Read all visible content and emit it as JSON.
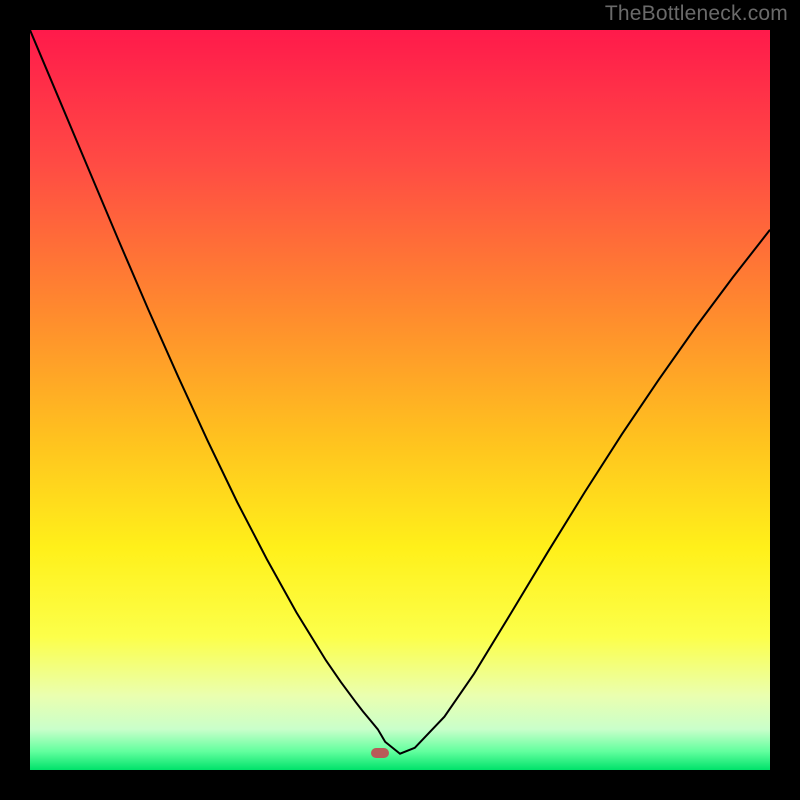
{
  "watermark": "TheBottleneck.com",
  "chart_data": {
    "type": "line",
    "title": "",
    "xlabel": "",
    "ylabel": "",
    "xlim": [
      0,
      100
    ],
    "ylim": [
      0,
      100
    ],
    "background_gradient": {
      "direction": "vertical",
      "stops": [
        {
          "pos": 0.0,
          "color": "#ff1a4b"
        },
        {
          "pos": 0.18,
          "color": "#ff4b44"
        },
        {
          "pos": 0.38,
          "color": "#ff8a2e"
        },
        {
          "pos": 0.55,
          "color": "#ffc11f"
        },
        {
          "pos": 0.7,
          "color": "#fff01a"
        },
        {
          "pos": 0.82,
          "color": "#fcff4a"
        },
        {
          "pos": 0.9,
          "color": "#eaffb0"
        },
        {
          "pos": 0.945,
          "color": "#c9ffca"
        },
        {
          "pos": 0.975,
          "color": "#62ff9e"
        },
        {
          "pos": 1.0,
          "color": "#00e26a"
        }
      ]
    },
    "series": [
      {
        "name": "bottleneck-curve",
        "color": "#000000",
        "x": [
          0,
          4,
          8,
          12,
          16,
          20,
          24,
          28,
          32,
          36,
          40,
          42,
          44,
          45,
          46,
          47,
          48,
          50,
          52,
          56,
          60,
          65,
          70,
          75,
          80,
          85,
          90,
          95,
          100
        ],
        "y": [
          100,
          90.5,
          81,
          71.5,
          62.2,
          53.2,
          44.5,
          36.2,
          28.5,
          21.3,
          14.8,
          11.9,
          9.2,
          7.9,
          6.7,
          5.5,
          3.8,
          2.2,
          3.0,
          7.2,
          13.0,
          21.2,
          29.5,
          37.6,
          45.4,
          52.8,
          59.9,
          66.6,
          73.0
        ]
      }
    ],
    "marker": {
      "name": "optimum-point",
      "x": 47.3,
      "y": 2.3,
      "color": "#b85a58"
    }
  }
}
